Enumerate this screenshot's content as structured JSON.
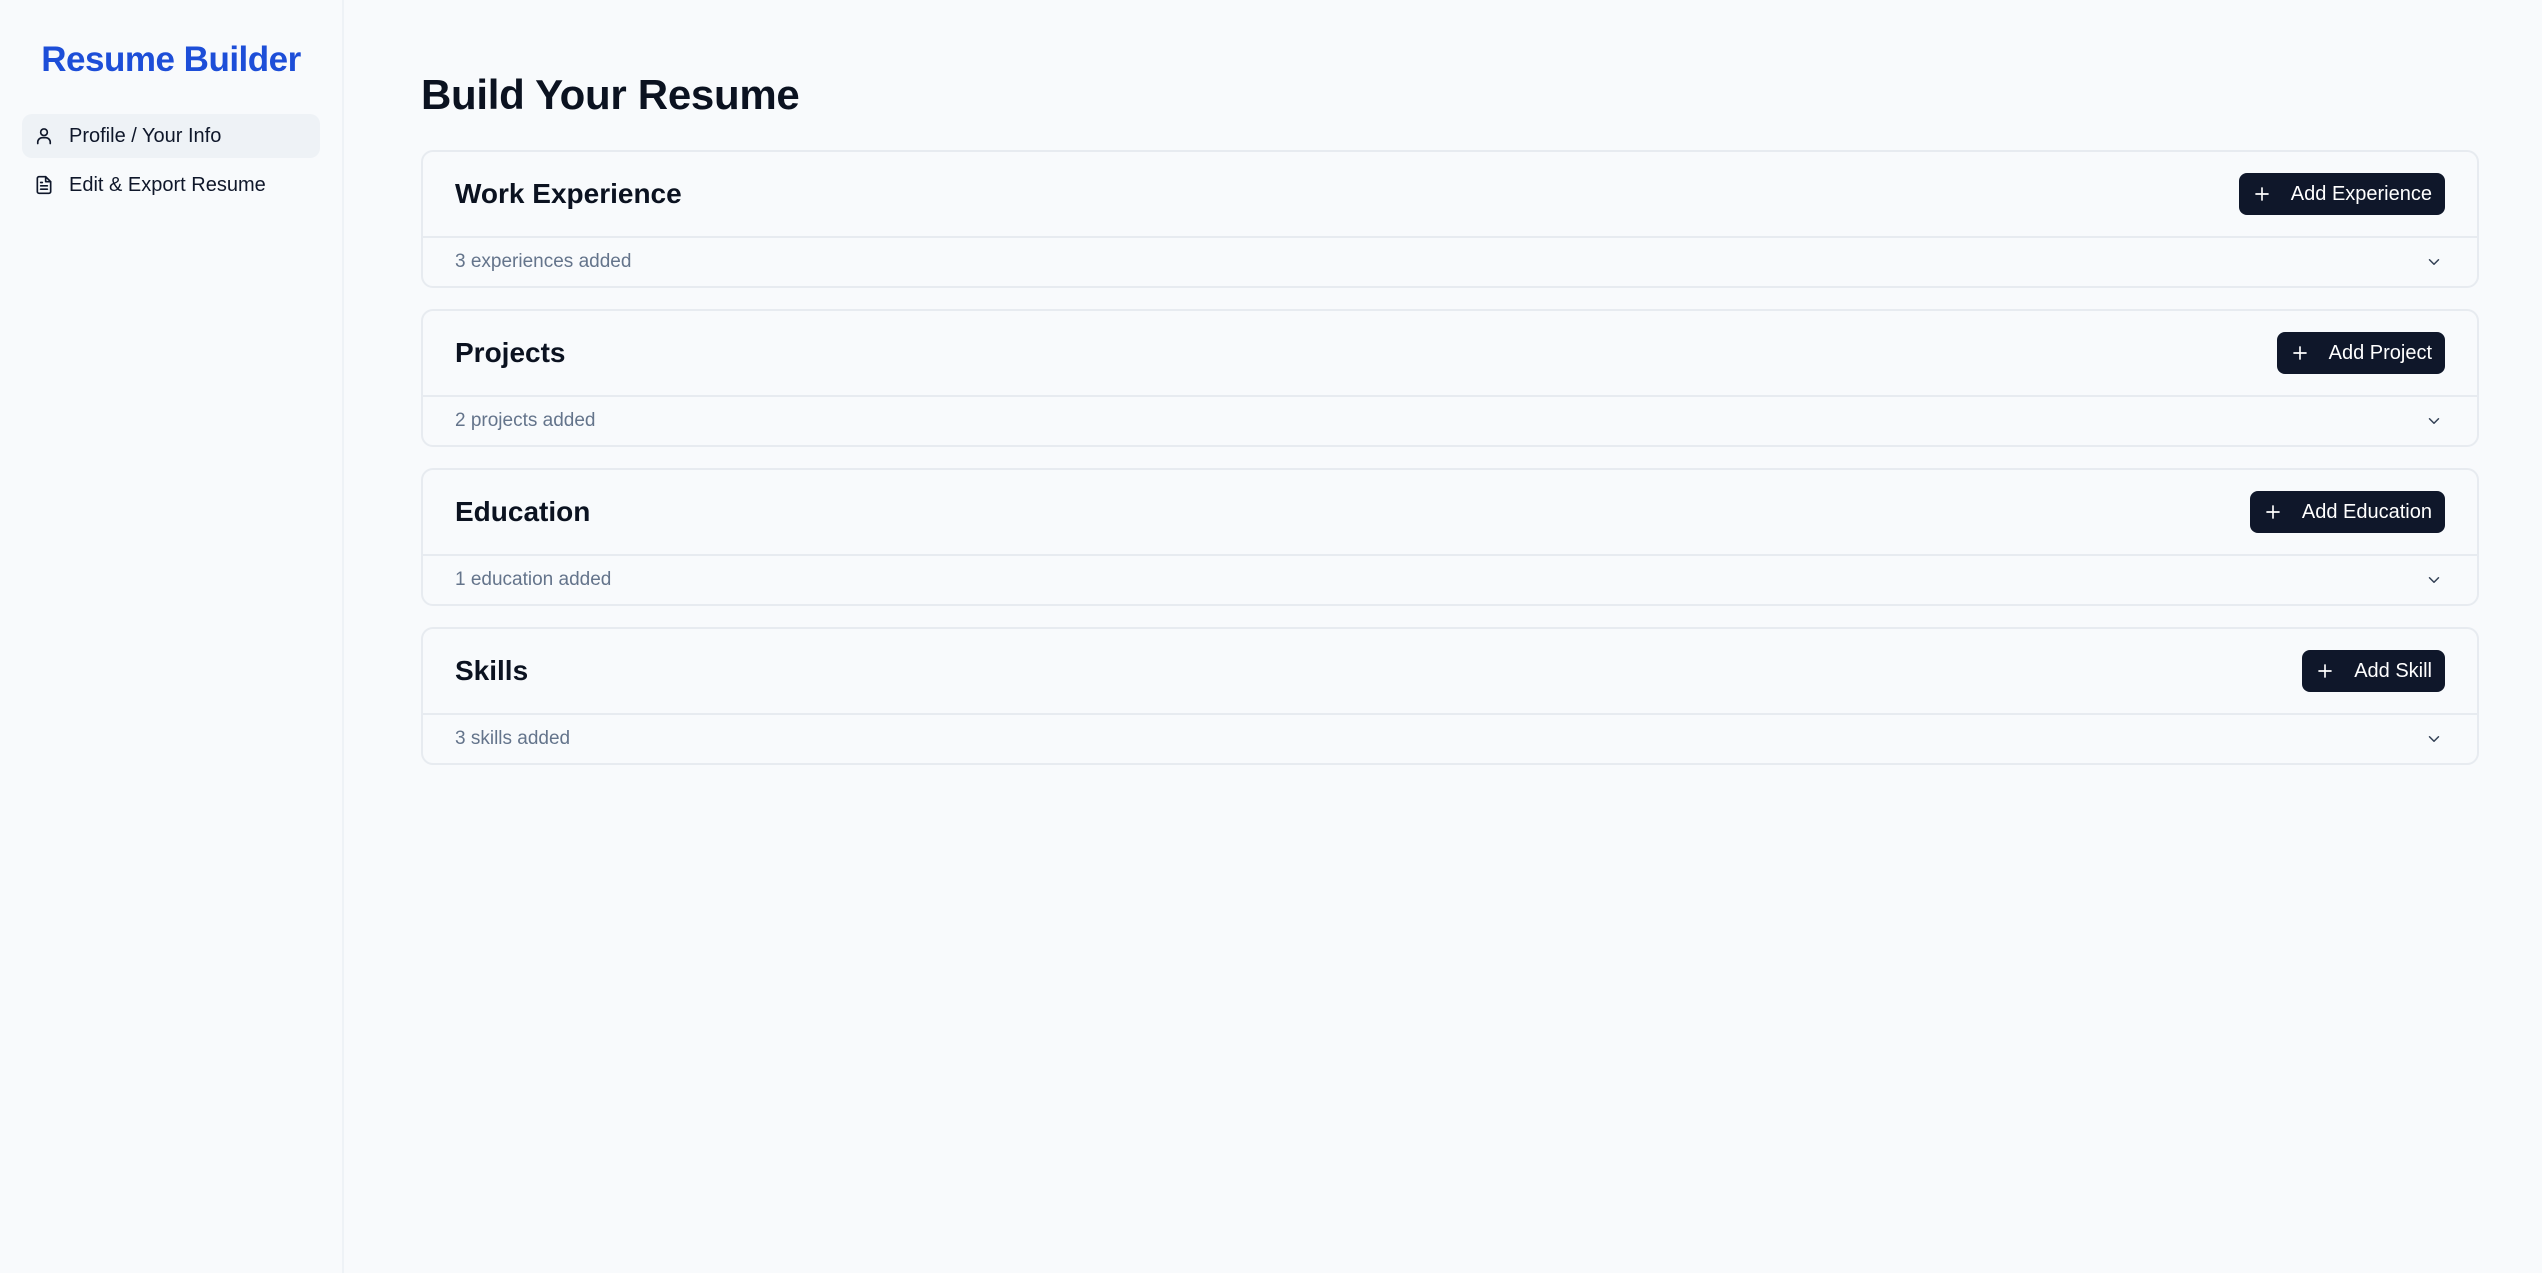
{
  "app": {
    "brand": "Resume Builder"
  },
  "sidebar": {
    "items": [
      {
        "label": "Profile / Your Info",
        "icon": "user-icon",
        "active": true
      },
      {
        "label": "Edit & Export Resume",
        "icon": "document-icon",
        "active": false
      }
    ]
  },
  "main": {
    "title": "Build Your Resume",
    "sections": [
      {
        "title": "Work Experience",
        "button": "Add Experience",
        "summary": "3 experiences added"
      },
      {
        "title": "Projects",
        "button": "Add Project",
        "summary": "2 projects added"
      },
      {
        "title": "Education",
        "button": "Add Education",
        "summary": "1 education added"
      },
      {
        "title": "Skills",
        "button": "Add Skill",
        "summary": "3 skills added"
      }
    ]
  },
  "colors": {
    "brand": "#1d4ed8",
    "button_bg": "#0f172a",
    "muted_text": "#64748b",
    "background": "#f8fafc"
  }
}
